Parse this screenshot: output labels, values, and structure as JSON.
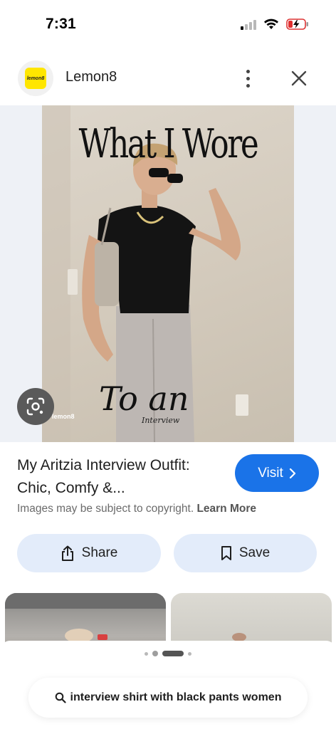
{
  "status_bar": {
    "time": "7:31"
  },
  "header": {
    "app_name": "Lemon8",
    "logo_text": "lemon8"
  },
  "image": {
    "overlay_title": "What I Wore",
    "overlay_script": "To an",
    "overlay_script_sub": "Interview",
    "watermark": "lemon8"
  },
  "result": {
    "title": "My Aritzia Interview Outfit: Chic, Comfy &...",
    "visit_label": "Visit",
    "copyright_text": "Images may be subject to copyright.",
    "learn_more_label": "Learn More"
  },
  "actions": {
    "share_label": "Share",
    "save_label": "Save"
  },
  "bottom": {
    "search_query": "interview shirt with black pants women"
  },
  "colors": {
    "accent": "#1a73e8",
    "action_button_bg": "#e3ecfa",
    "logo_yellow": "#ffe600"
  }
}
